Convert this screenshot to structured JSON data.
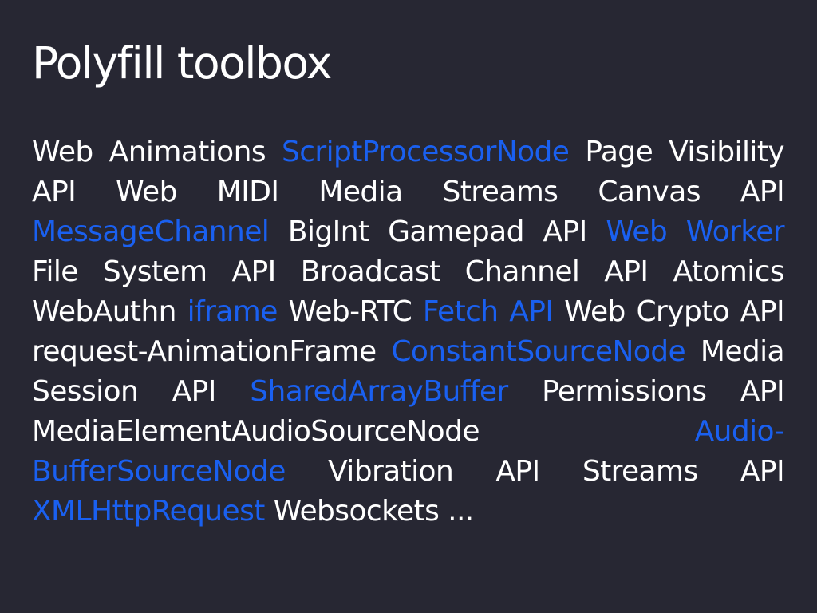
{
  "slide": {
    "title": "Polyfill toolbox",
    "colors": {
      "background": "#272733",
      "text": "#ffffff",
      "link": "#1a60f0"
    },
    "terms": [
      {
        "text": "Web Animations",
        "highlight": false
      },
      {
        "text": "ScriptProcessorNode",
        "highlight": true
      },
      {
        "text": "Page Visibility API",
        "highlight": false
      },
      {
        "text": "Web MIDI",
        "highlight": false
      },
      {
        "text": "Media Streams",
        "highlight": false
      },
      {
        "text": "Canvas API",
        "highlight": false
      },
      {
        "text": "MessageChannel",
        "highlight": true
      },
      {
        "text": "BigInt",
        "highlight": false
      },
      {
        "text": "Gamepad API",
        "highlight": false
      },
      {
        "text": "Web Worker",
        "highlight": true
      },
      {
        "text": "File System API",
        "highlight": false
      },
      {
        "text": "Broadcast Channel API",
        "highlight": false
      },
      {
        "text": "Atomics",
        "highlight": false
      },
      {
        "text": "WebAuthn",
        "highlight": false
      },
      {
        "text": "iframe",
        "highlight": true
      },
      {
        "text": "Web-RTC",
        "highlight": false
      },
      {
        "text": "Fetch API",
        "highlight": true
      },
      {
        "text": "Web Crypto API",
        "highlight": false
      },
      {
        "text": "request-AnimationFrame",
        "highlight": false
      },
      {
        "text": "ConstantSourceNode",
        "highlight": true
      },
      {
        "text": "Media Session API",
        "highlight": false
      },
      {
        "text": "SharedArrayBuffer",
        "highlight": true
      },
      {
        "text": "Permissions API",
        "highlight": false
      },
      {
        "text": "MediaElementAudioSourceNode",
        "highlight": false
      },
      {
        "text": "Audio-BufferSourceNode",
        "highlight": true
      },
      {
        "text": "Vibration API",
        "highlight": false
      },
      {
        "text": "Streams API",
        "highlight": false
      },
      {
        "text": "XMLHttpRequest",
        "highlight": true
      },
      {
        "text": "Websockets",
        "highlight": false
      },
      {
        "text": "...",
        "highlight": false
      }
    ]
  }
}
